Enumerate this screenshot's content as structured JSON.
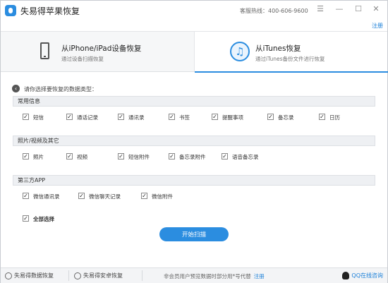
{
  "app": {
    "title": "失易得苹果恢复",
    "hotline": "客服热线：400-606-9600",
    "register": "注册"
  },
  "window_controls": {
    "menu": "☰",
    "minimize": "—",
    "maximize": "☐",
    "close": "✕"
  },
  "modes": [
    {
      "title": "从iPhone/iPad设备恢复",
      "subtitle": "通过设备扫描恢复",
      "icon": "phone-icon"
    },
    {
      "title": "从iTunes恢复",
      "subtitle": "通过iTunes备份文件进行恢复",
      "icon": "music-icon"
    }
  ],
  "prompt": "请你选择要恢复的数据类型：",
  "sections": [
    {
      "title": "常用信息",
      "items": [
        "短信",
        "通话记录",
        "通讯录",
        "书签",
        "提醒事项",
        "备忘录",
        "日历"
      ]
    },
    {
      "title": "照片/视频及其它",
      "items": [
        "照片",
        "视频",
        "短信附件",
        "备忘录附件",
        "语音备忘录"
      ]
    },
    {
      "title": "第三方APP",
      "items": [
        "微信通讯录",
        "微信聊天记录",
        "微信附件"
      ]
    }
  ],
  "check_mark": "✓",
  "select_all": "全部选择",
  "scan_button": "开始扫描",
  "footer": {
    "data_recovery": "失易得数据恢复",
    "android_recovery": "失易得安卓恢复",
    "note": "非会员用户预览数据时部分用*号代替",
    "register": "注册",
    "qq": "QQ在线咨询"
  },
  "colors": {
    "accent": "#2b8de0",
    "link": "#1a7fd8"
  }
}
